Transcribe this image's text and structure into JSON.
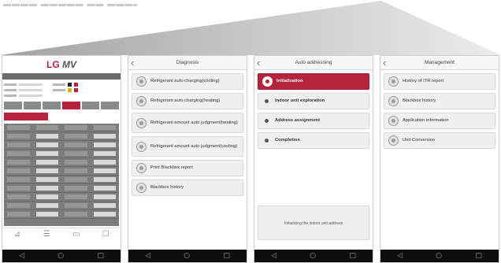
{
  "banner": {
    "color_left": "#9a9a9a",
    "color_right": "#f0f0f0"
  },
  "colors": {
    "accent": "#b5233c"
  },
  "lgmv": {
    "logo_a": "LG",
    "logo_b": "MV",
    "bottom_tabs": [
      {
        "icon": "chart-icon",
        "glyph": "⊿"
      },
      {
        "icon": "list-icon",
        "glyph": "☰"
      },
      {
        "icon": "window-icon",
        "glyph": "▭"
      },
      {
        "icon": "document-icon",
        "glyph": "☐"
      }
    ]
  },
  "diagnosis": {
    "title": "Diagnosis",
    "back_icon": "back-icon",
    "items": [
      {
        "label": "Refrigerant auto charging(cooling)",
        "tall": false
      },
      {
        "label": "Refrigerant auto charging(heating)",
        "tall": false
      },
      {
        "label": "Refrigerant amount auto judgment(heating)",
        "tall": true
      },
      {
        "label": "Refrigerant amount auto judgment(cooling)",
        "tall": true
      },
      {
        "label": "Print Blackbox report",
        "tall": false
      },
      {
        "label": "Blackbox history",
        "tall": false
      }
    ]
  },
  "auto_addressing": {
    "title": "Auto addressing",
    "items": [
      {
        "label": "Initialization",
        "active": true
      },
      {
        "label": "Indoor unit exploration",
        "active": false
      },
      {
        "label": "Address assignment",
        "active": false
      },
      {
        "label": "Completion",
        "active": false
      }
    ],
    "status": "Initializing the indoor unit address"
  },
  "management": {
    "title": "Management",
    "items": [
      {
        "label": "History of ITR report"
      },
      {
        "label": "Blackbox history"
      },
      {
        "label": "Application information"
      },
      {
        "label": "Unit Conversion"
      }
    ]
  },
  "system_nav": {
    "back": "◁",
    "home": "○",
    "recent": "□"
  }
}
